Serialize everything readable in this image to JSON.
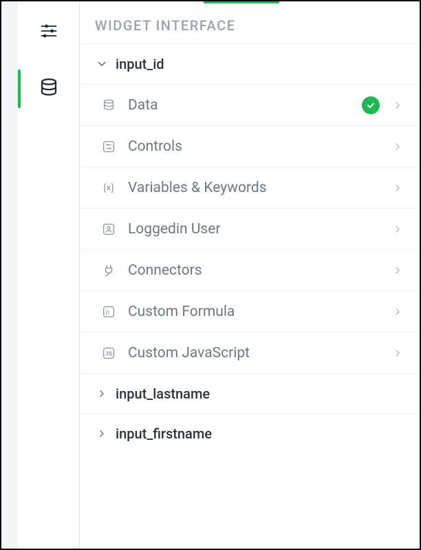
{
  "header": {
    "title": "WIDGET INTERFACE"
  },
  "tree": {
    "expanded_node": {
      "label": "input_id"
    },
    "items": [
      {
        "label": "Data",
        "icon": "data-icon",
        "checked": true
      },
      {
        "label": "Controls",
        "icon": "controls-icon",
        "checked": false
      },
      {
        "label": "Variables & Keywords",
        "icon": "variables-icon",
        "checked": false
      },
      {
        "label": "Loggedin User",
        "icon": "user-icon",
        "checked": false
      },
      {
        "label": "Connectors",
        "icon": "plug-icon",
        "checked": false
      },
      {
        "label": "Custom Formula",
        "icon": "fx-icon",
        "checked": false
      },
      {
        "label": "Custom JavaScript",
        "icon": "js-icon",
        "checked": false
      }
    ],
    "collapsed_nodes": [
      {
        "label": "input_lastname"
      },
      {
        "label": "input_firstname"
      }
    ]
  },
  "colors": {
    "accent": "#1db954",
    "text_muted": "#6d7880",
    "border": "#eceeef"
  }
}
